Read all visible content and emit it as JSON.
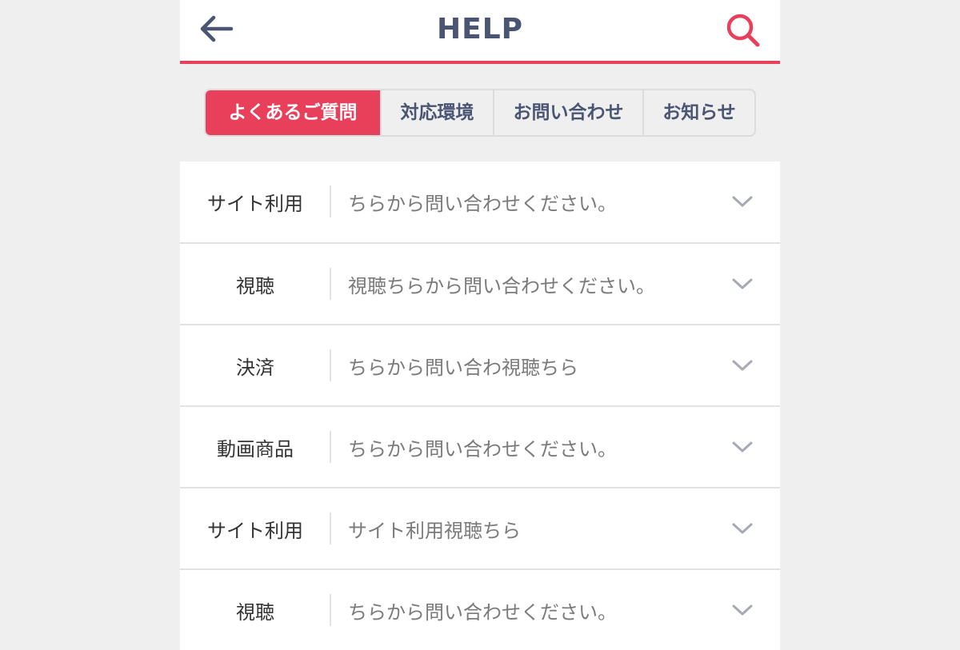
{
  "header": {
    "title": "HELP",
    "back_icon": "arrow-left-icon",
    "search_icon": "search-icon"
  },
  "colors": {
    "accent": "#e8405a",
    "navy": "#4a5473",
    "chevron": "#a7aab6"
  },
  "tabs": [
    {
      "label": "よくあるご質問",
      "active": true
    },
    {
      "label": "対応環境",
      "active": false
    },
    {
      "label": "お問い合わせ",
      "active": false
    },
    {
      "label": "お知らせ",
      "active": false
    }
  ],
  "faq": [
    {
      "category": "サイト利用",
      "question": "ちらから問い合わせください。"
    },
    {
      "category": "視聴",
      "question": "視聴ちらから問い合わせください。"
    },
    {
      "category": "決済",
      "question": "ちらから問い合わ視聴ちら"
    },
    {
      "category": "動画商品",
      "question": "ちらから問い合わせください。"
    },
    {
      "category": "サイト利用",
      "question": "サイト利用視聴ちら"
    },
    {
      "category": "視聴",
      "question": "ちらから問い合わせください。"
    }
  ]
}
